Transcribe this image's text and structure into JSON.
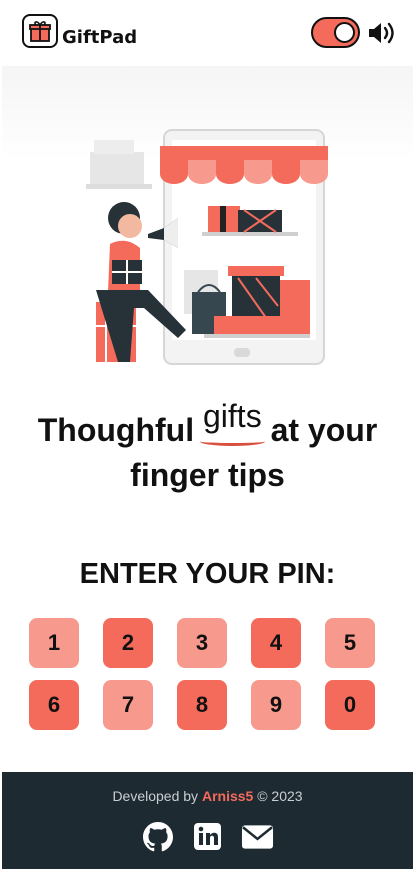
{
  "app": {
    "title": "GiftPad"
  },
  "header": {
    "logo_icon": "gift-icon",
    "sound_toggle": {
      "on": true,
      "icon": "speaker-icon"
    }
  },
  "colors": {
    "accent": "#f46b5c",
    "key_light": "#f7998d",
    "key_dark": "#f46b5c",
    "footer_bg": "#1e2a32"
  },
  "hero": {
    "tagline_part1": "Thoughful",
    "tagline_highlight": "gifts",
    "tagline_part2": "at your",
    "tagline_part3": "finger tips"
  },
  "pin": {
    "title": "ENTER YOUR PIN:",
    "keys": [
      "1",
      "2",
      "3",
      "4",
      "5",
      "6",
      "7",
      "8",
      "9",
      "0"
    ]
  },
  "footer": {
    "developed_by": "Developed by",
    "author": "Arniss5",
    "copyright": "© 2023",
    "social": [
      "github-icon",
      "linkedin-icon",
      "mail-icon"
    ]
  }
}
